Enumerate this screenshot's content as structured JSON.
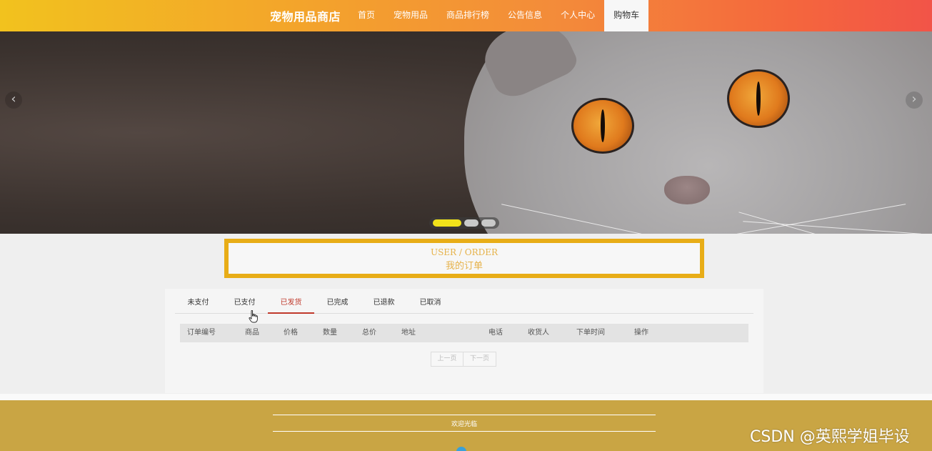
{
  "header": {
    "brand": "宠物用品商店",
    "nav": [
      "首页",
      "宠物用品",
      "商品排行榜",
      "公告信息",
      "个人中心",
      "购物车"
    ],
    "active_index": 5
  },
  "banner": {
    "prev_glyph": "‹",
    "next_glyph": "›",
    "slide_count": 3,
    "active_slide": 1
  },
  "section_title": {
    "en": "USER / ORDER",
    "cn": "我的订单"
  },
  "orders": {
    "tabs": [
      "未支付",
      "已支付",
      "已发货",
      "已完成",
      "已退款",
      "已取消"
    ],
    "active_tab": 2,
    "columns": [
      "订单编号",
      "商品",
      "价格",
      "数量",
      "总价",
      "地址",
      "电话",
      "收货人",
      "下单时间",
      "操作"
    ],
    "rows": [],
    "pager": {
      "prev": "上一页",
      "next": "下一页"
    }
  },
  "footer": {
    "text": "欢迎光临"
  },
  "watermark": "CSDN @英熙学姐毕设",
  "colors": {
    "accent": "#e8ad17",
    "active_tab": "#c0392b",
    "footer_bg": "#c9a544",
    "title_text": "#e6b24a"
  },
  "icons": {
    "prev": "chevron-left-icon",
    "next": "chevron-right-icon",
    "cursor": "hand-pointer-icon"
  }
}
